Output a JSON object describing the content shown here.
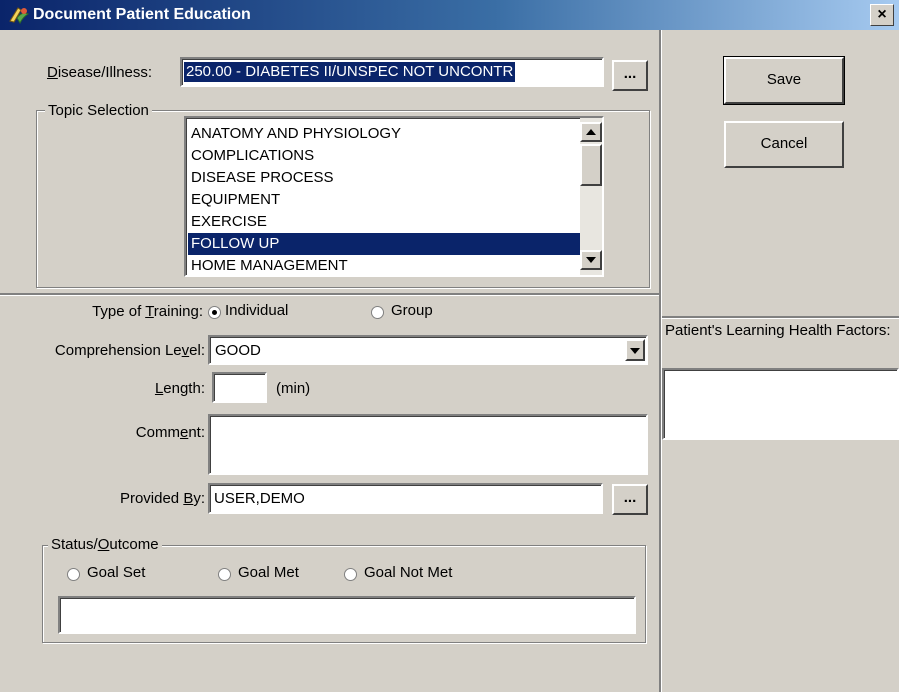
{
  "window": {
    "title": "Document Patient Education",
    "close_label": "×"
  },
  "disease": {
    "label": "Disease/Illness:",
    "value": "250.00 - DIABETES II/UNSPEC NOT UNCONTR",
    "lookup_label": "..."
  },
  "topic": {
    "legend": "Topic Selection",
    "items": [
      "ANATOMY AND PHYSIOLOGY",
      "COMPLICATIONS",
      "DISEASE PROCESS",
      "EQUIPMENT",
      "EXERCISE",
      "FOLLOW UP",
      "HOME MANAGEMENT"
    ],
    "selected": "FOLLOW UP"
  },
  "training": {
    "label": "Type of Training:",
    "options": [
      "Individual",
      "Group"
    ],
    "selected": "Individual"
  },
  "comprehension": {
    "label": "Comprehension Level:",
    "value": "GOOD"
  },
  "length": {
    "label": "Length:",
    "value": "",
    "unit": "(min)"
  },
  "comment": {
    "label": "Comment:",
    "value": ""
  },
  "provided_by": {
    "label": "Provided By:",
    "value": "USER,DEMO",
    "lookup_label": "..."
  },
  "status": {
    "legend": "Status/Outcome",
    "options": [
      "Goal Set",
      "Goal Met",
      "Goal Not Met"
    ],
    "selected": null,
    "text": ""
  },
  "buttons": {
    "save": "Save",
    "cancel": "Cancel"
  },
  "learning": {
    "header": "Patient's Learning Health Factors:",
    "value": ""
  }
}
